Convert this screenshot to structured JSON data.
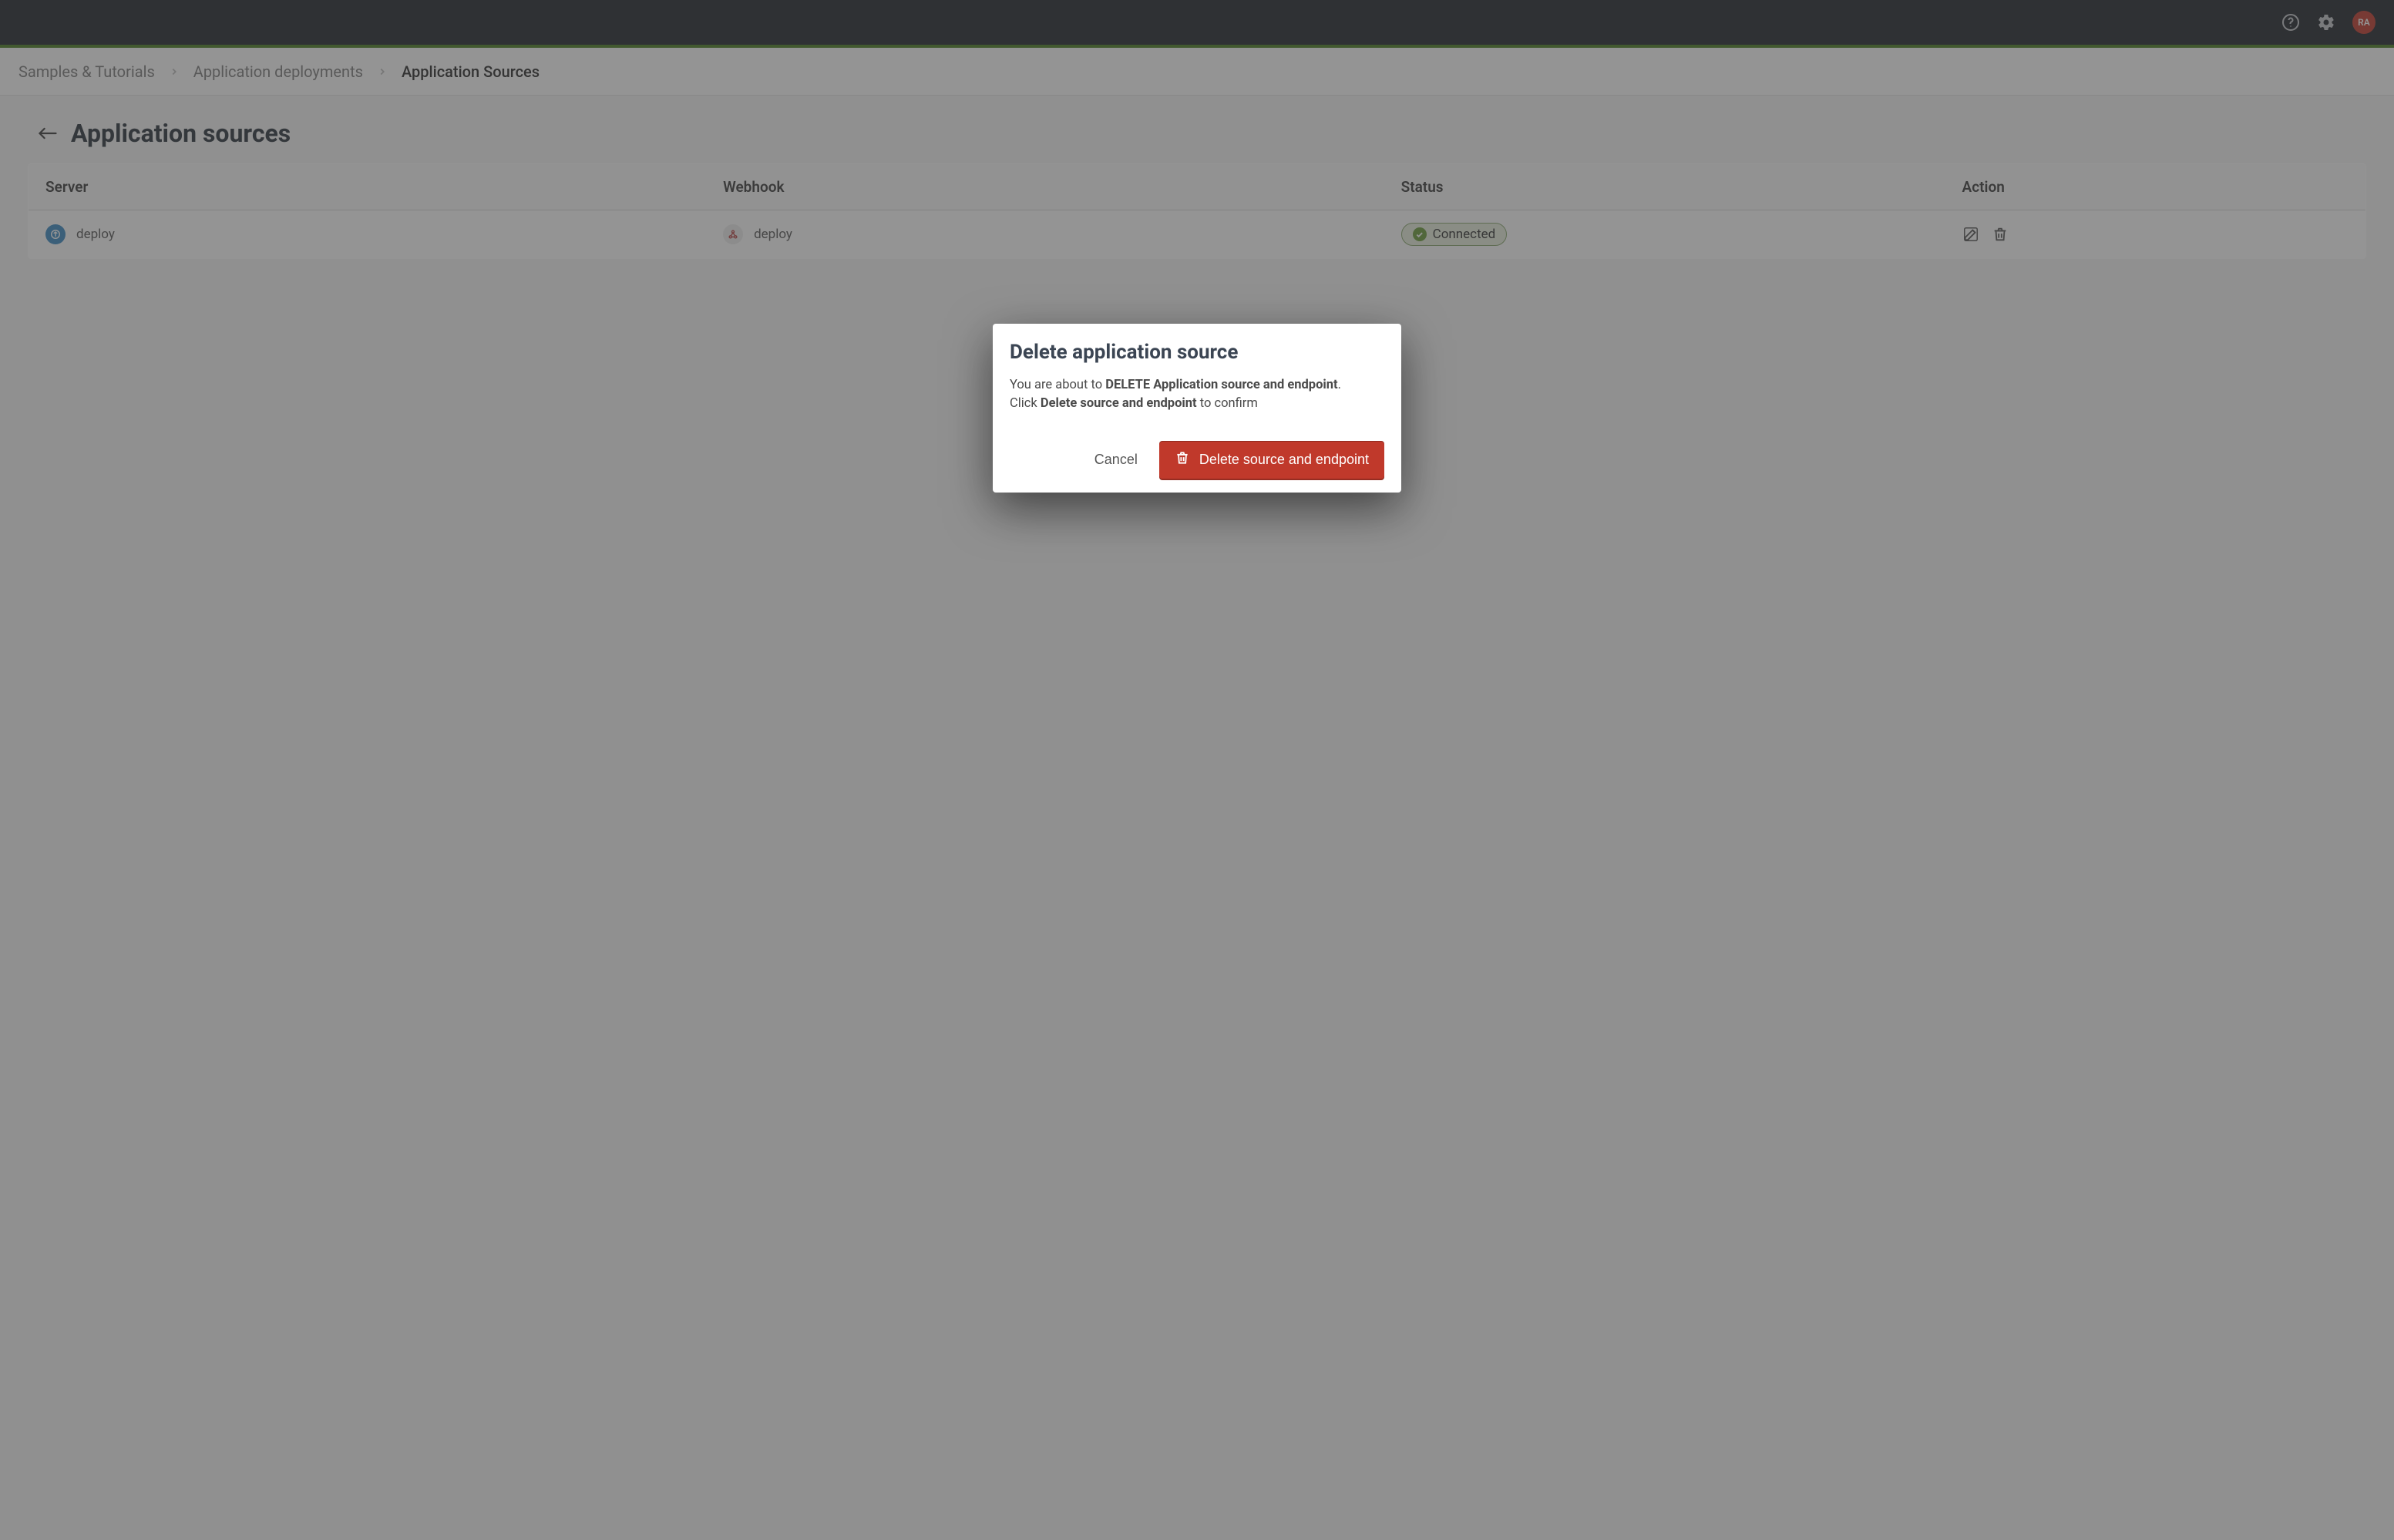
{
  "topbar": {
    "avatar_initials": "RA"
  },
  "breadcrumbs": {
    "items": [
      {
        "label": "Samples & Tutorials"
      },
      {
        "label": "Application deployments"
      },
      {
        "label": "Application Sources"
      }
    ]
  },
  "page": {
    "title": "Application sources"
  },
  "table": {
    "headers": {
      "server": "Server",
      "webhook": "Webhook",
      "status": "Status",
      "action": "Action"
    },
    "rows": [
      {
        "server": "deploy",
        "webhook": "deploy",
        "status": "Connected"
      }
    ]
  },
  "modal": {
    "title": "Delete application source",
    "line1_prefix": "You are about to ",
    "line1_bold": "DELETE Application source and endpoint",
    "line1_suffix": ".",
    "line2_prefix": "Click ",
    "line2_bold": "Delete source and endpoint",
    "line2_suffix": " to confirm",
    "cancel_label": "Cancel",
    "delete_label": "Delete source and endpoint"
  }
}
